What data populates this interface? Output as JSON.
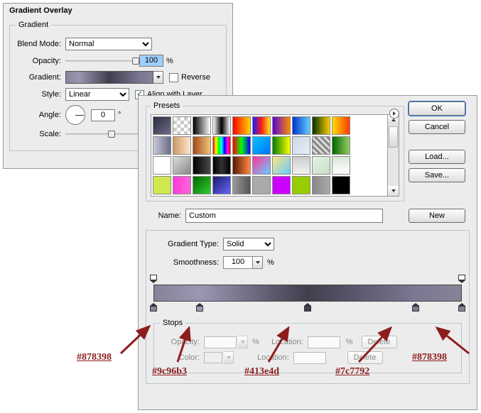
{
  "overlay": {
    "title": "Gradient Overlay",
    "legend": "Gradient",
    "blend_label": "Blend Mode:",
    "blend_value": "Normal",
    "opacity_label": "Opacity:",
    "opacity_value": "100",
    "opacity_unit": "%",
    "gradient_label": "Gradient:",
    "reverse_label": "Reverse",
    "reverse_checked": false,
    "style_label": "Style:",
    "style_value": "Linear",
    "align_label": "Align with Layer",
    "align_checked": true,
    "angle_label": "Angle:",
    "angle_value": "0",
    "angle_unit": "°",
    "scale_label": "Scale:"
  },
  "editor": {
    "presets_label": "Presets",
    "ok": "OK",
    "cancel": "Cancel",
    "load": "Load...",
    "save": "Save...",
    "name_label": "Name:",
    "name_value": "Custom",
    "new": "New",
    "type_label": "Gradient Type:",
    "type_value": "Solid",
    "smooth_label": "Smoothness:",
    "smooth_value": "100",
    "smooth_unit": "%",
    "stops_legend": "Stops",
    "opacity_lbl": "Opacity:",
    "location_lbl": "Location:",
    "color_lbl": "Color:",
    "delete_lbl": "Delete",
    "pct": "%",
    "color_stops": [
      {
        "pos": 0,
        "color": "#878398"
      },
      {
        "pos": 15,
        "color": "#9c96b3"
      },
      {
        "pos": 50,
        "color": "#413e4d"
      },
      {
        "pos": 85,
        "color": "#7c7792"
      },
      {
        "pos": 100,
        "color": "#878398"
      }
    ],
    "opacity_stops": [
      {
        "pos": 0
      },
      {
        "pos": 100
      }
    ],
    "preset_swatches": [
      "linear-gradient(135deg,#2b2b3a,#6d6d8a)",
      "repeating-conic-gradient(#ccc 0 25%,#fff 0 50%) 0 0/10px 10px",
      "linear-gradient(90deg,#000,#fff)",
      "linear-gradient(90deg,#fff,#000,#fff)",
      "linear-gradient(90deg,#ff0000,#ffd400)",
      "linear-gradient(90deg,#1a1aff,#ff1a1a,#ffe81a)",
      "linear-gradient(90deg,#5a00d8,#ff8c00)",
      "linear-gradient(90deg,#0033cc,#66ccff)",
      "linear-gradient(90deg,#003300,#ffcc00)",
      "linear-gradient(90deg,#ffde00,#ff8a00,#ff3b00)",
      "linear-gradient(90deg,#c8c8d8,#6d6d8a)",
      "linear-gradient(90deg,#cc9966,#ffe6cc)",
      "linear-gradient(90deg,#a04b1a,#f2c27a)",
      "linear-gradient(90deg,#ff0000,#ffff00,#00ff00,#00ffff,#0000ff,#ff00ff,#ff0000)",
      "linear-gradient(90deg,#ff0000,#00ff00,#0000ff)",
      "linear-gradient(135deg,#00c6ff,#0072ff)",
      "linear-gradient(90deg,#008000,#ffff00)",
      "linear-gradient(135deg,#ccd6e6,#e9eef6)",
      "repeating-linear-gradient(45deg,#888 0 3px,#ddd 3px 6px)",
      "linear-gradient(90deg,#006600,#99cc66)",
      "#ffffff",
      "linear-gradient(135deg,#dddddd,#888888)",
      "linear-gradient(90deg,#000,#4a4a4a)",
      "linear-gradient(90deg,#000,#333,#000)",
      "linear-gradient(90deg,#5a1a00,#ff8844)",
      "linear-gradient(135deg,#ff3399,#66ccff)",
      "linear-gradient(135deg,#ffe680,#66ccff)",
      "linear-gradient(180deg,#cccccc,#f2f2f2)",
      "linear-gradient(135deg,#e6f2e6,#c4e0c4)",
      "linear-gradient(180deg,#d9e6d9,#ffffff)",
      "#d0e850",
      "linear-gradient(90deg,#ff3bd4,#ff66dc)",
      "linear-gradient(135deg,#006600,#33cc33)",
      "linear-gradient(135deg,#1a1a66,#6666ff)",
      "linear-gradient(90deg,#999,#555)",
      "#aaaaaa",
      "#cc00ff",
      "#99cc00",
      "linear-gradient(90deg,#888,#aaa)",
      "#000000"
    ]
  },
  "annotations": {
    "a1": "#878398",
    "a2": "#9c96b3",
    "a3": "#413e4d",
    "a4": "#7c7792",
    "a5": "#878398"
  }
}
